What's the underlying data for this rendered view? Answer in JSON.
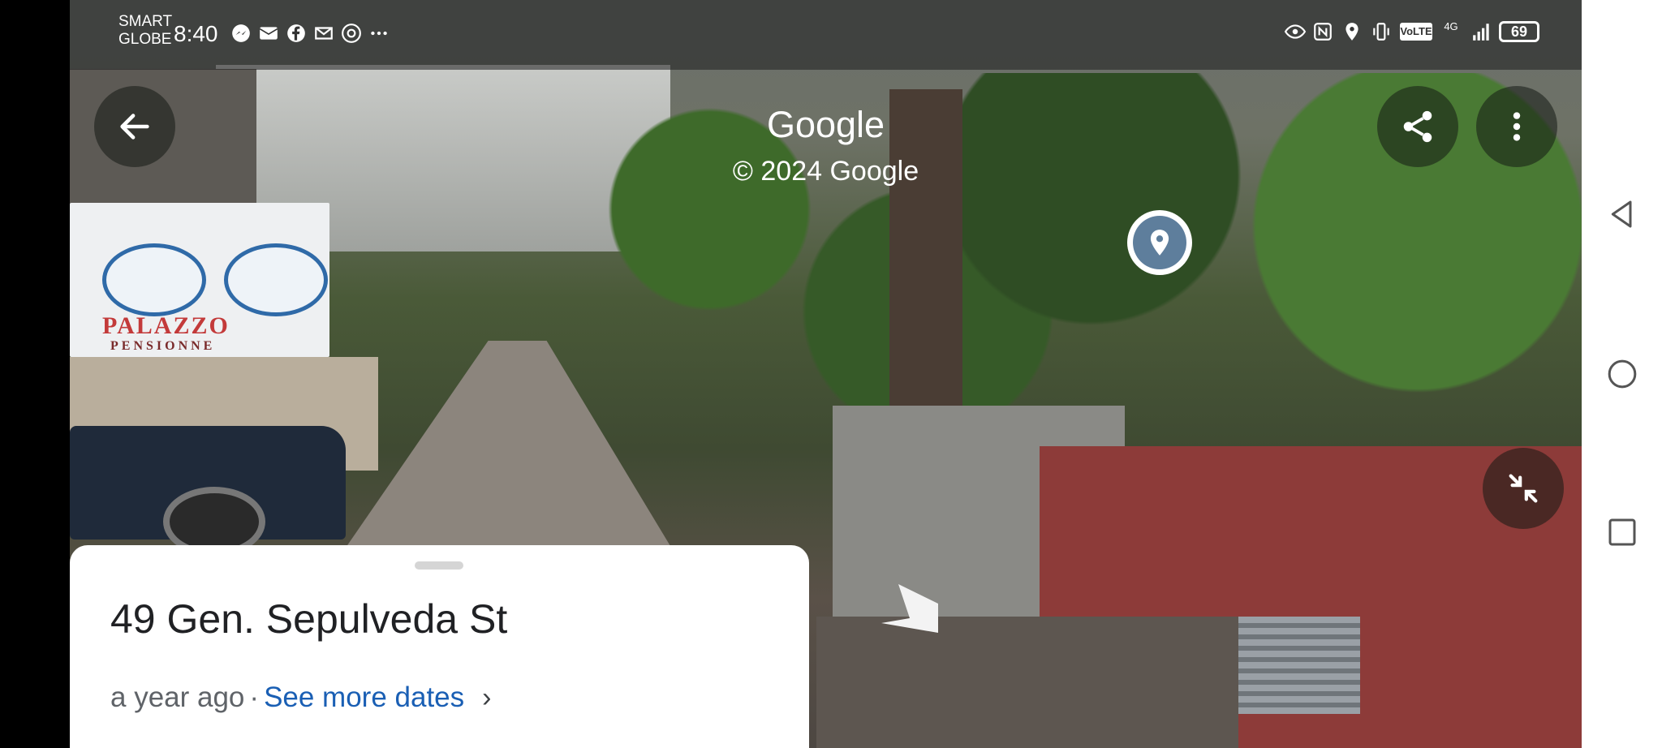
{
  "status_bar": {
    "carrier_line1": "SMART",
    "carrier_line2": "GLOBE",
    "time": "8:40",
    "left_icons": [
      "messenger-icon",
      "mail-icon",
      "facebook-icon",
      "gmail-icon",
      "chrome-icon",
      "more-icon"
    ],
    "right_icons": [
      "eye-icon",
      "nfc-icon",
      "location-icon",
      "vibrate-icon",
      "volte-icon",
      "4g-signal-icon",
      "signal-icon",
      "battery-icon"
    ],
    "volte_label": "VoLTE",
    "network_label": "4G",
    "battery_level": "69"
  },
  "overlay": {
    "brand": "Google",
    "copyright": "© 2024 Google",
    "back_icon": "arrow-left-icon",
    "share_icon": "share-icon",
    "menu_icon": "more-vert-icon",
    "minimize_icon": "collapse-icon",
    "pin_icon": "location-pin-icon"
  },
  "scene": {
    "sign_line1": "PALAZZO",
    "sign_line2": "PENSIONNE"
  },
  "card": {
    "address": "49 Gen. Sepulveda St",
    "age": "a year ago",
    "separator": "·",
    "link": "See more dates",
    "chevron": "›"
  },
  "navbar": {
    "items": [
      "back-triangle-icon",
      "home-circle-icon",
      "recents-square-icon"
    ]
  }
}
